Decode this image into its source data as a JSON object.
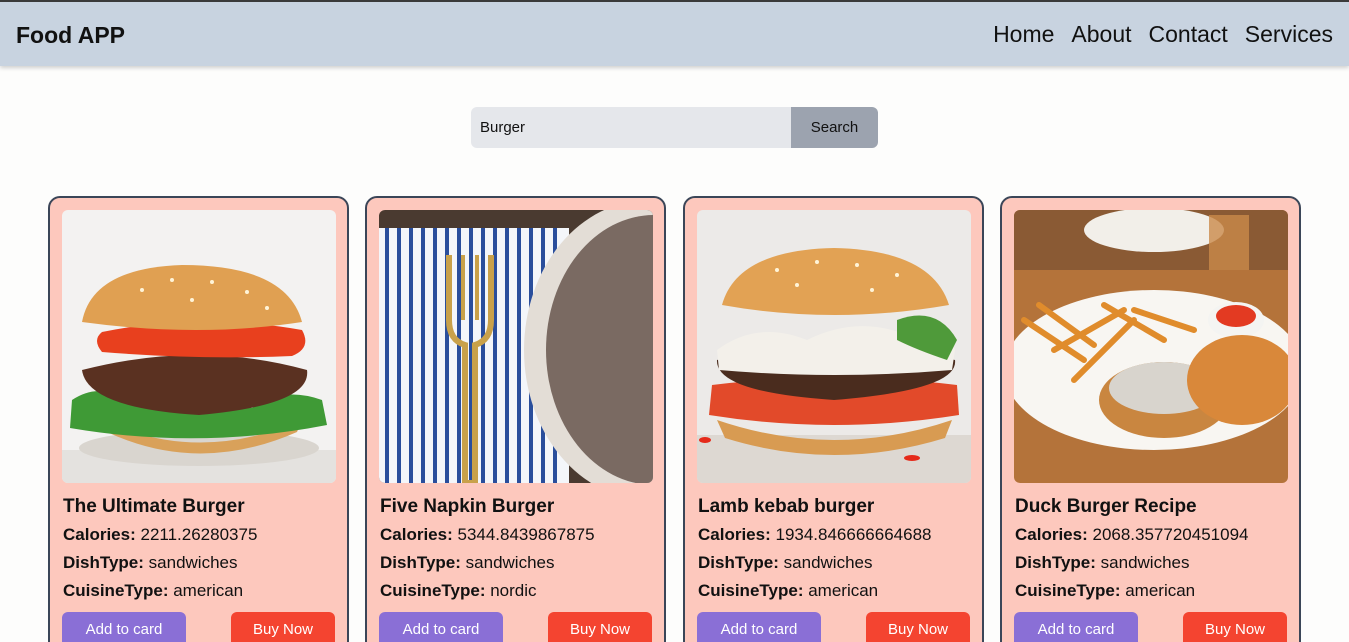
{
  "navbar": {
    "brand": "Food APP",
    "links": [
      "Home",
      "About",
      "Contact",
      "Services"
    ]
  },
  "search": {
    "value": "Burger",
    "placeholder": "",
    "button_label": "Search"
  },
  "labels": {
    "calories": "Calories:",
    "dish_type": "DishType:",
    "cuisine_type": "CuisineType:"
  },
  "cards": [
    {
      "title": "The Ultimate Burger",
      "calories": "2211.26280375",
      "dish_type": "sandwiches",
      "cuisine_type": "american",
      "add_label": "Add to card",
      "buy_label": "Buy Now",
      "image": "burger-photo"
    },
    {
      "title": "Five Napkin Burger",
      "calories": "5344.8439867875",
      "dish_type": "sandwiches",
      "cuisine_type": "nordic",
      "add_label": "Add to card",
      "buy_label": "Buy Now",
      "image": "fork-napkin-photo"
    },
    {
      "title": "Lamb kebab burger",
      "calories": "1934.846666664688",
      "dish_type": "sandwiches",
      "cuisine_type": "american",
      "add_label": "Add to card",
      "buy_label": "Buy Now",
      "image": "kebab-burger-photo"
    },
    {
      "title": "Duck Burger Recipe",
      "calories": "2068.357720451094",
      "dish_type": "sandwiches",
      "cuisine_type": "american",
      "add_label": "Add to card",
      "buy_label": "Buy Now",
      "image": "burger-fries-plate-photo"
    }
  ],
  "colors": {
    "navbar_bg": "#c8d3e0",
    "card_bg": "#fdc8bd",
    "card_border": "#3b4658",
    "add_button": "#8a6fd6",
    "buy_button": "#f44430",
    "search_button": "#9ca3af",
    "search_input_bg": "#e5e7eb"
  }
}
